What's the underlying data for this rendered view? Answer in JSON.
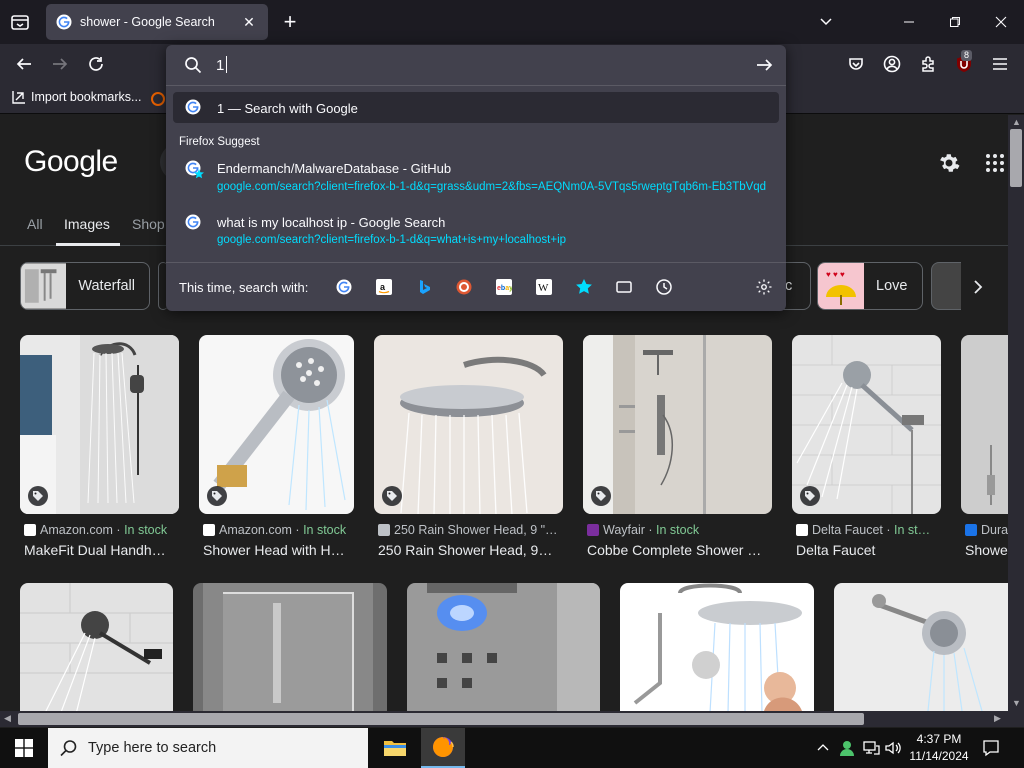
{
  "browser": {
    "tab_title": "shower - Google Search",
    "bookmark_label": "Import bookmarks...",
    "ext_badge": "8"
  },
  "urlbar": {
    "query": "1",
    "results": [
      {
        "title": "1 — Search with Google",
        "url": ""
      },
      {
        "title": "Endermanch/MalwareDatabase - GitHub",
        "url": "google.com/search?client=firefox-b-1-d&q=grass&udm=2&fbs=AEQNm0A-5VTqs5rweptgTqb6m-Eb3TbVqd"
      },
      {
        "title": "what is my localhost ip - Google Search",
        "url": "google.com/search?client=firefox-b-1-d&q=what+is+my+localhost+ip"
      }
    ],
    "group_label": "Firefox Suggest",
    "engines_label": "This time, search with:"
  },
  "page": {
    "logo": "Google",
    "tabs": [
      "All",
      "Images",
      "Shop"
    ],
    "chips": [
      {
        "label": "Waterfall"
      },
      {
        "label": "c"
      },
      {
        "label": "Love"
      }
    ],
    "images_row1": [
      {
        "source": "Amazon.com",
        "stock": "In stock",
        "title": "MakeFit Dual Handh…"
      },
      {
        "source": "Amazon.com",
        "stock": "In stock",
        "title": "Shower Head with H…"
      },
      {
        "source": "250 Rain Shower Head, 9 \"…",
        "stock": "",
        "title": "250 Rain Shower Head, 9…"
      },
      {
        "source": "Wayfair",
        "stock": "In stock",
        "title": "Cobbe Complete Shower …"
      },
      {
        "source": "Delta Faucet",
        "stock": "In st…",
        "title": "Delta Faucet"
      },
      {
        "source": "Dura",
        "stock": "",
        "title": "Showe"
      }
    ]
  },
  "taskbar": {
    "search_placeholder": "Type here to search",
    "time": "4:37 PM",
    "date": "11/14/2024"
  },
  "colors": {
    "accent_link": "#00ddff",
    "in_stock": "#81c995",
    "chrome_bg": "#2b2a33"
  }
}
